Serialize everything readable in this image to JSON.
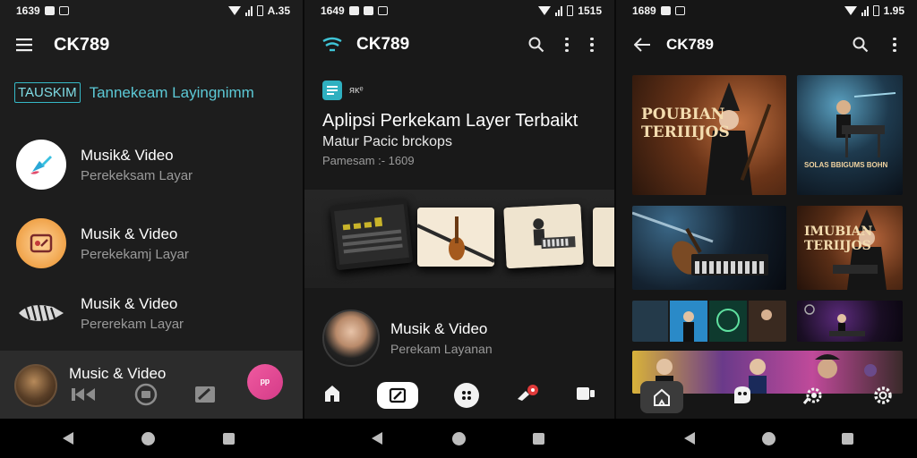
{
  "screen1": {
    "status": {
      "time": "1639"
    },
    "appbar": {
      "title": "CK789",
      "menu_icon": "hamburger-icon"
    },
    "tag": {
      "label": "TAUSKIM",
      "text": "Tannekeam Layingnimm"
    },
    "items": [
      {
        "title": "Musik& Video",
        "subtitle": "Perekeksam Layar",
        "icon": "brush-icon",
        "color": "#ffffff"
      },
      {
        "title": "Musik & Video",
        "subtitle": "Perekekamj Layar",
        "icon": "screen-recorder-icon",
        "color": "#f0a34a"
      },
      {
        "title": "Musik & Video",
        "subtitle": "Pererekam Layar",
        "icon": "striped-shell-icon",
        "color": "#1d1d1d"
      }
    ],
    "miniplayer": {
      "title": "Music & Video",
      "cta": "ᵖᵖ"
    }
  },
  "screen2": {
    "status": {
      "time": "1649",
      "right": "1515"
    },
    "appbar": {
      "title": "CK789"
    },
    "chip": {
      "label": "ᴙᴋᵉ"
    },
    "heading": "Aplipsi Perkekam Layer Terbaikt",
    "subheading": "Matur Pacic brckops",
    "meta": "Pamesam :- 1609",
    "profile": {
      "title": "Musik & Video",
      "subtitle": "Perekam Layanan"
    }
  },
  "screen3": {
    "status": {
      "time": "1689",
      "right": "1.95"
    },
    "appbar": {
      "title": "CK789"
    },
    "cards": [
      {
        "title_line1": "POUBIAN",
        "title_line2": "TERIIIJOS"
      },
      {
        "caption": "SOLAS BBIGUMS BOHN"
      },
      {
        "title_line1": "IMUBIAN",
        "title_line2": "TERIIJOS"
      }
    ]
  },
  "statusbar_left_time_1": "1639",
  "statusbar_right_1": "A.35"
}
